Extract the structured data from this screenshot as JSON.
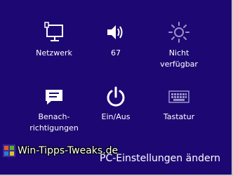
{
  "tiles": [
    {
      "key": "network",
      "label": "Netzwerk",
      "icon": "network-icon"
    },
    {
      "key": "volume",
      "label": "67",
      "icon": "speaker-icon"
    },
    {
      "key": "brightness",
      "label_line1": "Nicht",
      "label_line2": "verfügbar",
      "icon": "brightness-icon"
    },
    {
      "key": "notifications",
      "label_line1": "Benach-",
      "label_line2": "richtigungen",
      "icon": "notifications-icon"
    },
    {
      "key": "power",
      "label": "Ein/Aus",
      "icon": "power-icon"
    },
    {
      "key": "keyboard",
      "label": "Tastatur",
      "icon": "keyboard-icon"
    }
  ],
  "watermark": {
    "text": "Win-Tipps-Tweaks.de"
  },
  "footer": {
    "settings_link": "PC-Einstellungen ändern"
  },
  "colors": {
    "background": "#1d0873",
    "text": "#ffffff",
    "disabled_icon": "#9a92c8"
  }
}
